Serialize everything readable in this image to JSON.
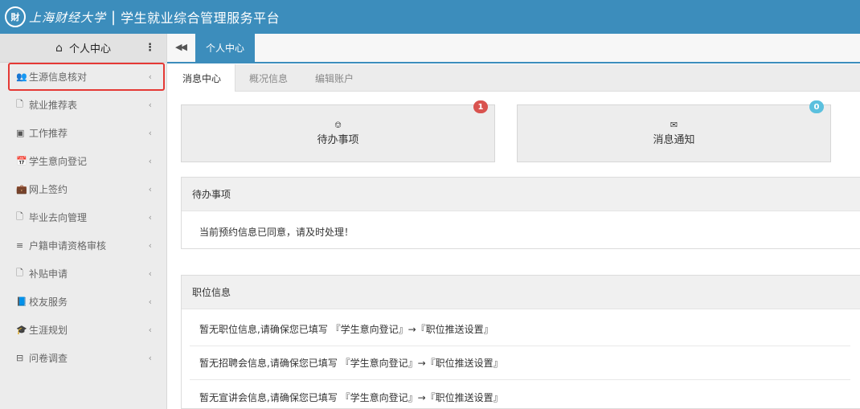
{
  "header": {
    "seal_text": "財",
    "school_name": "上海财经大学",
    "separator": "|",
    "platform_title": "学生就业综合管理服务平台"
  },
  "sidebar": {
    "head_icon": "home-icon",
    "head_label": "个人中心",
    "head_menu_glyph": "⋮",
    "items": [
      {
        "label": "生源信息核对",
        "icon": "users-icon",
        "glyph": "👥"
      },
      {
        "label": "就业推荐表",
        "icon": "file-icon",
        "glyph": "🗋"
      },
      {
        "label": "工作推荐",
        "icon": "square-dot-icon",
        "glyph": "▣"
      },
      {
        "label": "学生意向登记",
        "icon": "calendar-icon",
        "glyph": "📅"
      },
      {
        "label": "网上签约",
        "icon": "briefcase-icon",
        "glyph": "💼"
      },
      {
        "label": "毕业去向管理",
        "icon": "file-icon",
        "glyph": "🗋"
      },
      {
        "label": "户籍申请资格审核",
        "icon": "list-icon",
        "glyph": "≡"
      },
      {
        "label": "补贴申请",
        "icon": "file-icon",
        "glyph": "🗋"
      },
      {
        "label": "校友服务",
        "icon": "book-icon",
        "glyph": "📘"
      },
      {
        "label": "生涯规划",
        "icon": "graduation-cap-icon",
        "glyph": "🎓"
      },
      {
        "label": "问卷调查",
        "icon": "minus-square-icon",
        "glyph": "⊟"
      }
    ],
    "chevron": "‹"
  },
  "tabbar": {
    "back_glyph": "◀◀",
    "active_tab": "个人中心"
  },
  "subtabs": [
    "消息中心",
    "概况信息",
    "编辑账户"
  ],
  "cards": [
    {
      "label": "待办事项",
      "icon": "bell-icon",
      "glyph": "🔔",
      "badge": "1",
      "badge_color": "#d9534f"
    },
    {
      "label": "消息通知",
      "icon": "envelope-icon",
      "glyph": "✉",
      "badge": "0",
      "badge_color": "#5bc0de"
    }
  ],
  "todo_panel": {
    "title": "待办事项",
    "rows": [
      "当前预约信息已同意，请及时处理！"
    ]
  },
  "job_panel": {
    "title": "职位信息",
    "rows": [
      "暂无职位信息,请确保您已填写 『学生意向登记』→『职位推送设置』",
      "暂无招聘会信息,请确保您已填写 『学生意向登记』→『职位推送设置』",
      "暂无宣讲会信息,请确保您已填写 『学生意向登记』→『职位推送设置』"
    ]
  },
  "colors": {
    "brand": "#3c8dbc",
    "highlight_box": "#e53935"
  }
}
